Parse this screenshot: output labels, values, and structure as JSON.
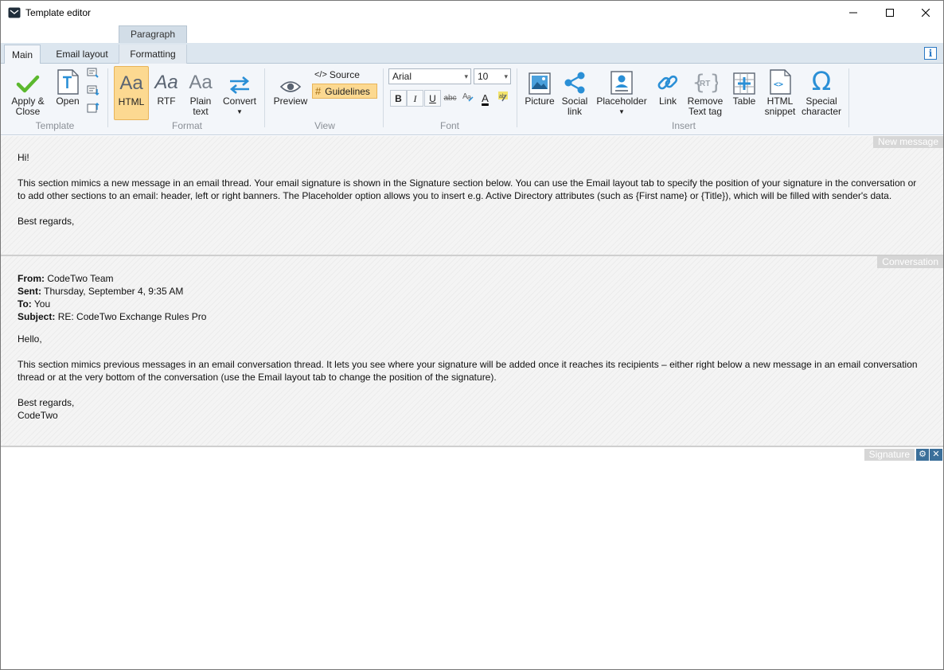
{
  "window": {
    "title": "Template editor"
  },
  "ribbon": {
    "context_group": "Paragraph",
    "tabs": [
      {
        "label": "Main",
        "active": true
      },
      {
        "label": "Email layout"
      },
      {
        "label": "Formatting"
      }
    ],
    "groups": {
      "template": {
        "label": "Template",
        "apply_close": "Apply &",
        "apply_close_2": "Close",
        "open": "Open"
      },
      "format": {
        "label": "Format",
        "html": "HTML",
        "rtf": "RTF",
        "plain": "Plain",
        "plain_2": "text",
        "convert": "Convert",
        "aa": "Aa"
      },
      "view": {
        "label": "View",
        "preview": "Preview",
        "source": "Source",
        "guidelines": "Guidelines"
      },
      "font": {
        "label": "Font",
        "family": "Arial",
        "size": "10",
        "bold": "B",
        "italic": "I",
        "underline": "U",
        "strike": "abc",
        "color": "A"
      },
      "insert": {
        "label": "Insert",
        "picture": "Picture",
        "social": "Social",
        "social_2": "link",
        "placeholder": "Placeholder",
        "link": "Link",
        "remove": "Remove",
        "remove_2": "Text tag",
        "table": "Table",
        "snippet": "HTML",
        "snippet_2": "snippet",
        "special": "Special",
        "special_2": "character"
      }
    }
  },
  "sections": {
    "new_message": {
      "tag": "New message",
      "greeting": "Hi!",
      "body": "This section mimics a new message in an email thread. Your email signature is shown in the Signature section below. You can use the Email layout tab to specify the position of your signature in the conversation or to add other sections to an email: header, left or right banners. The Placeholder option allows you to insert e.g. Active Directory attributes (such as {First name} or {Title}), which will be filled with sender's data.",
      "closing": "Best regards,"
    },
    "conversation": {
      "tag": "Conversation",
      "from_label": "From:",
      "from": "CodeTwo Team",
      "sent_label": "Sent:",
      "sent": "Thursday, September 4, 9:35 AM",
      "to_label": "To:",
      "to": "You",
      "subject_label": "Subject:",
      "subject": "RE: CodeTwo Exchange Rules Pro",
      "greeting": "Hello,",
      "body": "This section mimics previous messages in an email conversation thread. It lets you see where your signature will be added once it reaches its recipients – either right below a new message in an email conversation thread or at the very bottom of the conversation (use the Email layout tab to change the position of the signature).",
      "closing": "Best regards,",
      "signoff": "CodeTwo"
    },
    "signature": {
      "tag": "Signature"
    }
  },
  "colors": {
    "accent": "#2a8fd6",
    "selected": "#fcd991",
    "check": "#5bb82e"
  }
}
